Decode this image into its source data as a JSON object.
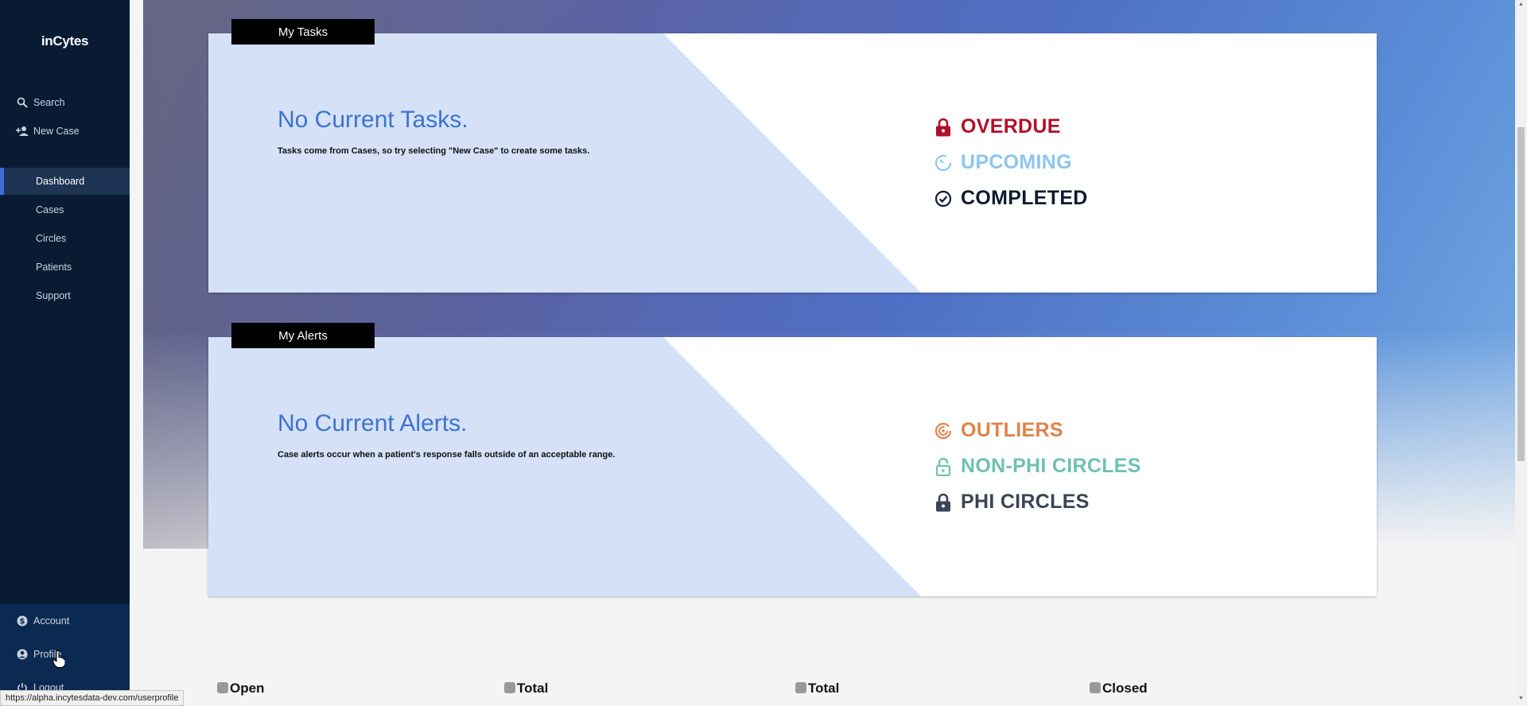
{
  "app": {
    "logo": "inCytes"
  },
  "sidebar": {
    "top_items": [
      {
        "label": "Search",
        "icon": "search-icon"
      },
      {
        "label": "New Case",
        "icon": "add-person-icon"
      }
    ],
    "nav_items": [
      {
        "label": "Dashboard",
        "active": true
      },
      {
        "label": "Cases"
      },
      {
        "label": "Circles"
      },
      {
        "label": "Patients"
      },
      {
        "label": "Support"
      }
    ],
    "bottom_items": [
      {
        "label": "Account",
        "icon": "dollar-icon"
      },
      {
        "label": "Profile",
        "icon": "user-circle-icon"
      },
      {
        "label": "Logout",
        "icon": "power-icon"
      }
    ]
  },
  "tasks": {
    "title": "My Tasks",
    "empty_heading": "No Current Tasks.",
    "empty_desc": "Tasks come from Cases, so try selecting \"New Case\" to create some tasks.",
    "legend": [
      {
        "label": "OVERDUE",
        "color": "#b0102a",
        "icon": "lock-icon"
      },
      {
        "label": "UPCOMING",
        "color": "#8ec5f0",
        "icon": "timer-icon"
      },
      {
        "label": "COMPLETED",
        "color": "#0d1a2e",
        "icon": "check-circle-icon"
      }
    ]
  },
  "alerts": {
    "title": "My Alerts",
    "empty_heading": "No Current Alerts.",
    "empty_desc": "Case alerts occur when a patient's response falls outside of an acceptable range.",
    "legend": [
      {
        "label": "OUTLIERS",
        "color": "#e0834a",
        "icon": "radar-icon"
      },
      {
        "label": "NON-PHI CIRCLES",
        "color": "#6fc1b0",
        "icon": "unlock-icon"
      },
      {
        "label": "PHI CIRCLES",
        "color": "#3a4457",
        "icon": "lock-icon"
      }
    ]
  },
  "stats": [
    {
      "label": "Open"
    },
    {
      "label": "Total"
    },
    {
      "label": "Total"
    },
    {
      "label": "Closed"
    }
  ],
  "statusbar": {
    "url": "https://alpha.incytesdata-dev.com/userprofile"
  },
  "colors": {
    "sidebar_bg": "#081b33",
    "accent": "#3b6fd6",
    "card_wedge": "#d4e1f7"
  }
}
